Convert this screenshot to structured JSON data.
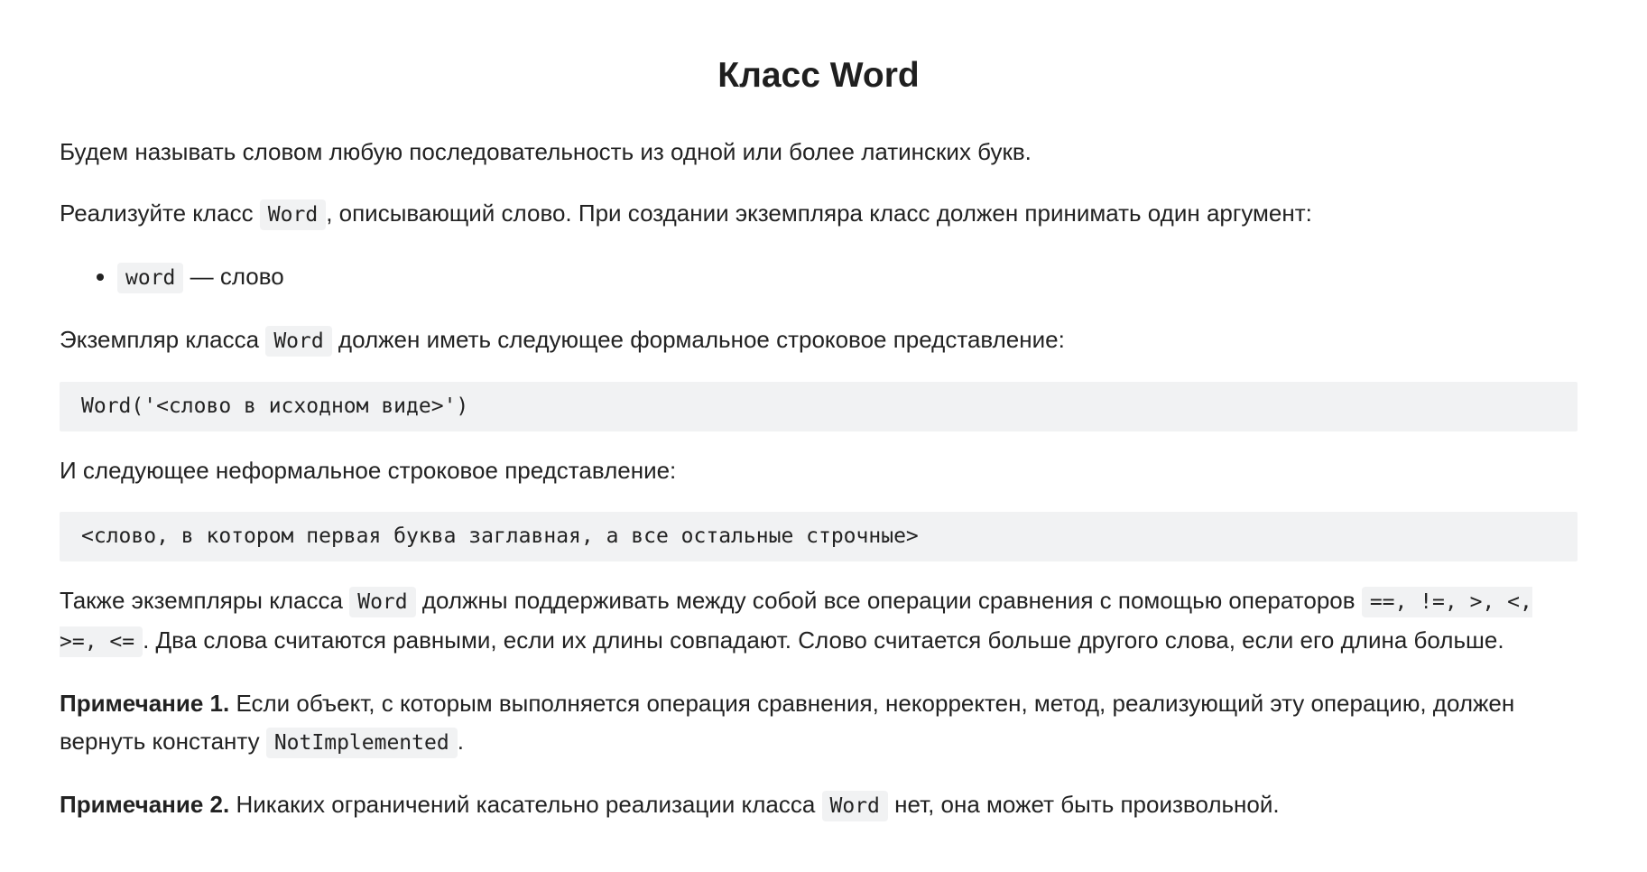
{
  "title": "Класс Word",
  "intro": "Будем называть словом любую последовательность из одной или более латинских букв.",
  "implement": {
    "before": "Реализуйте класс ",
    "code": "Word",
    "after": ", описывающий слово. При создании экземпляра класс должен принимать один аргумент:"
  },
  "args": [
    {
      "code": "word",
      "text": " — слово"
    }
  ],
  "repr": {
    "before": "Экземпляр класса ",
    "code": "Word",
    "after": " должен иметь следующее формальное строковое представление:"
  },
  "repr_block": "Word('<слово в исходном виде>')",
  "str_intro": "И следующее неформальное строковое представление:",
  "str_block": "<слово, в котором первая буква заглавная, а все остальные строчные>",
  "compare": {
    "before": "Также экземпляры класса ",
    "code": "Word",
    "middle": " должны поддерживать между собой все операции сравнения с помощью операторов ",
    "operators": "==, !=, >, <, >=, <=",
    "after": ". Два слова считаются равными, если их длины совпадают. Слово считается больше другого слова, если его длина больше."
  },
  "note1": {
    "label": "Примечание 1.",
    "text": " Если объект, с которым выполняется операция сравнения, некорректен, метод, реализующий эту операцию, должен вернуть константу ",
    "code": "NotImplemented",
    "after": "."
  },
  "note2": {
    "label": "Примечание 2.",
    "text": " Никаких ограничений касательно реализации класса ",
    "code": "Word",
    "after": " нет, она может быть произвольной."
  }
}
